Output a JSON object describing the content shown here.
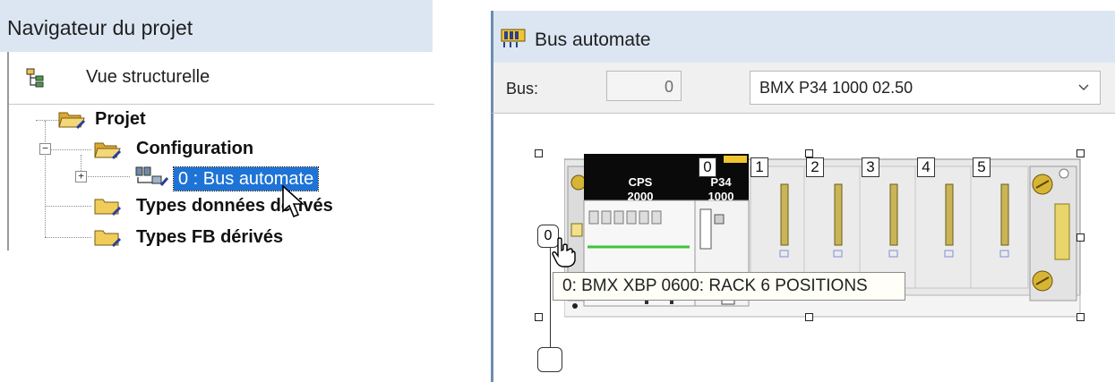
{
  "navigator": {
    "title": "Navigateur du projet",
    "view_label": "Vue structurelle",
    "tree": {
      "root": "Projet",
      "configuration": "Configuration",
      "selected_item": "0 : Bus automate",
      "derived_types": "Types données dérivés",
      "fb_types": "Types FB dérivés"
    }
  },
  "bus_window": {
    "title": "Bus automate",
    "bus_label": "Bus:",
    "bus_number": "0",
    "processor_select": "BMX P34 1000   02.50",
    "rack": {
      "rack_number": "0",
      "slots": [
        "0",
        "1",
        "2",
        "3",
        "4",
        "5"
      ],
      "power_module": {
        "line1": "CPS",
        "line2": "2000"
      },
      "cpu_module": {
        "line1": "P34",
        "line2": "1000"
      },
      "tooltip": "0: BMX XBP 0600: RACK 6 POSITIONS"
    }
  },
  "colors": {
    "header_bg": "#dbe6f2",
    "selection": "#1e73d6",
    "folder": "#e8c454",
    "module_black": "#0a0a0a",
    "rack_gray": "#e6e6e6",
    "connector_gold": "#c8b450"
  }
}
